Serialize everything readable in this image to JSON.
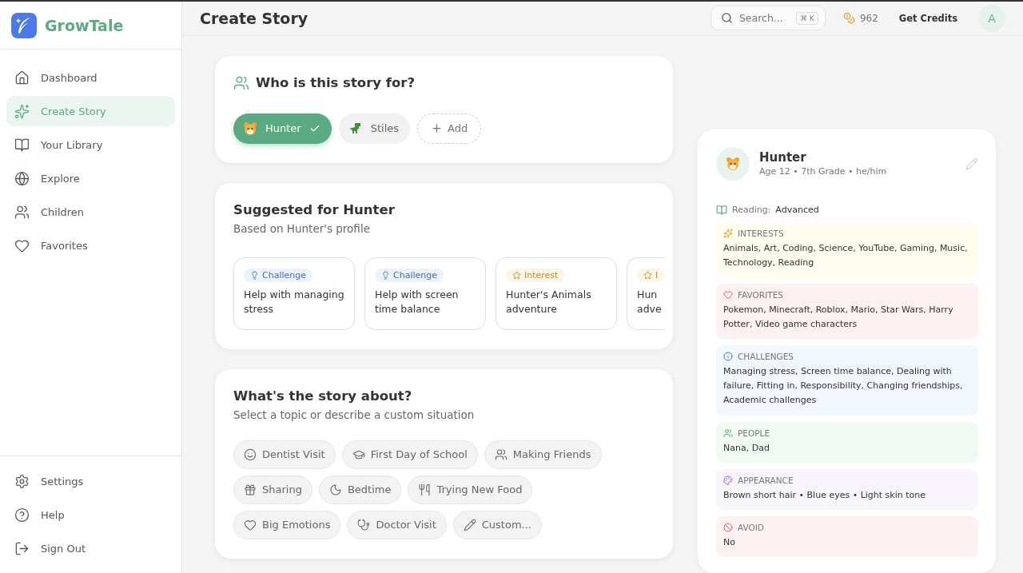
{
  "brand": {
    "name": "GrowTale"
  },
  "sidebar": {
    "items": [
      {
        "label": "Dashboard",
        "selected": false
      },
      {
        "label": "Create Story",
        "selected": true
      },
      {
        "label": "Your Library",
        "selected": false
      },
      {
        "label": "Explore",
        "selected": false
      },
      {
        "label": "Children",
        "selected": false
      },
      {
        "label": "Favorites",
        "selected": false
      }
    ],
    "footer_items": [
      {
        "label": "Settings"
      },
      {
        "label": "Help"
      },
      {
        "label": "Sign Out"
      }
    ]
  },
  "header": {
    "title": "Create Story",
    "search": {
      "placeholder": "Search...",
      "shortcut": "⌘ K"
    },
    "credits": "962",
    "get_credits": "Get Credits",
    "avatar": "A"
  },
  "who_for": {
    "title": "Who is this story for?",
    "children": [
      {
        "name": "Hunter",
        "kind": "tiger",
        "selected": true
      },
      {
        "name": "Stiles",
        "kind": "dino",
        "selected": false
      }
    ],
    "add": "Add"
  },
  "suggested": {
    "title": "Suggested for Hunter",
    "subtitle": "Based on Hunter's profile",
    "cards": [
      {
        "kind": "challenge",
        "tag": "Challenge",
        "title": "Help with managing stress"
      },
      {
        "kind": "challenge",
        "tag": "Challenge",
        "title": "Help with screen time balance"
      },
      {
        "kind": "interest",
        "tag": "Interest",
        "title": "Hunter's Animals adventure"
      },
      {
        "kind": "interest",
        "tag": "I",
        "title": "Hun adve"
      }
    ]
  },
  "topic": {
    "title": "What's the story about?",
    "subtitle": "Select a topic or describe a custom situation",
    "topics": [
      {
        "label": "Dentist Visit"
      },
      {
        "label": "First Day of School"
      },
      {
        "label": "Making Friends"
      },
      {
        "label": "Sharing"
      },
      {
        "label": "Bedtime"
      },
      {
        "label": "Trying New Food"
      },
      {
        "label": "Big Emotions"
      },
      {
        "label": "Doctor Visit"
      },
      {
        "label": "Custom..."
      }
    ]
  },
  "profile": {
    "name": "Hunter",
    "details": "Age 12 • 7th Grade • he/him",
    "reading_label": "Reading:",
    "reading_value": "Advanced",
    "sections": [
      {
        "kind": "interests",
        "title": "INTERESTS",
        "text": "Animals, Art, Coding, Science, YouTube, Gaming, Music, Technology, Reading"
      },
      {
        "kind": "favorites",
        "title": "FAVORITES",
        "text": "Pokemon, Minecraft, Roblox, Mario, Star Wars, Harry Potter, Video game characters"
      },
      {
        "kind": "challenges",
        "title": "CHALLENGES",
        "text": "Managing stress, Screen time balance, Dealing with failure, Fitting in, Responsibility, Changing friendships, Academic challenges"
      },
      {
        "kind": "people",
        "title": "PEOPLE",
        "text": "Nana, Dad"
      },
      {
        "kind": "appearance",
        "title": "APPEARANCE",
        "text": "Brown short hair • Blue eyes • Light skin tone"
      },
      {
        "kind": "avoid",
        "title": "AVOID",
        "text": "No"
      }
    ]
  }
}
